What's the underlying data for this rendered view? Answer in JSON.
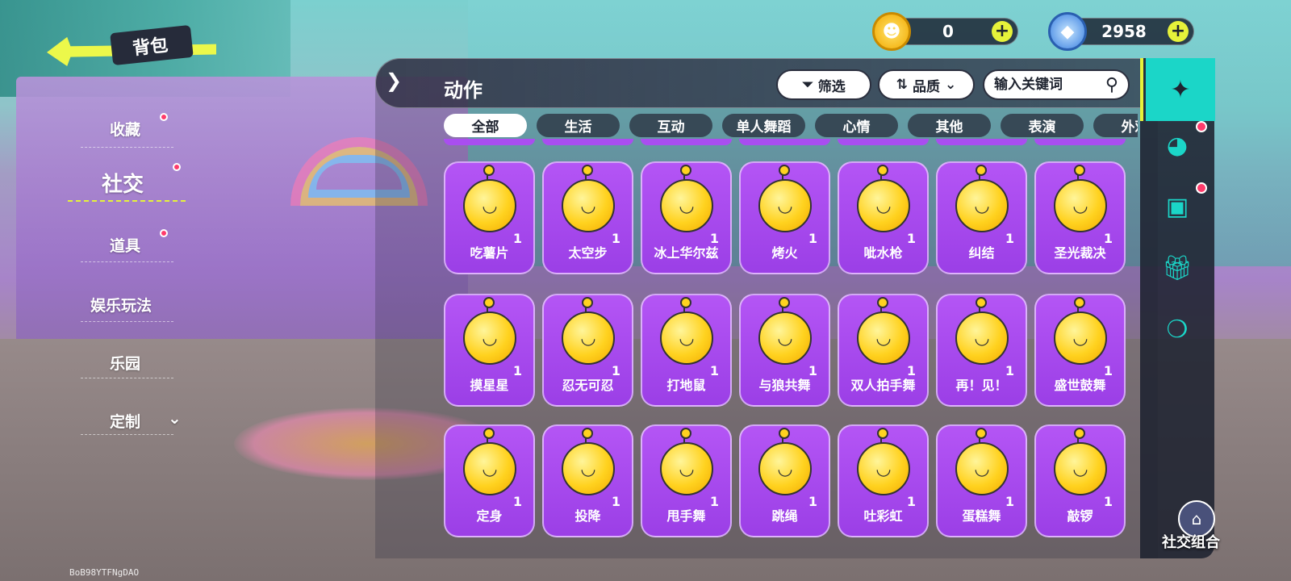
{
  "header": {
    "back_label": "背包"
  },
  "currencies": [
    {
      "name": "coin-currency",
      "amount": "0",
      "plus": "+"
    },
    {
      "name": "gem-currency",
      "amount": "2958",
      "plus": "+"
    }
  ],
  "left_nav": {
    "items": [
      {
        "label": "收藏",
        "has_dot": true
      },
      {
        "label": "社交",
        "has_dot": true,
        "active": true
      },
      {
        "label": "道具",
        "has_dot": true
      },
      {
        "label": "娱乐玩法",
        "has_dot": false
      },
      {
        "label": "乐园",
        "has_dot": false
      },
      {
        "label": "定制",
        "has_dot": false,
        "expand_icon": "chevron-down-icon"
      }
    ]
  },
  "panel": {
    "title": "动作",
    "filter_label": "筛选",
    "sort_label": "品质",
    "search_placeholder": "输入关键词"
  },
  "tabs": [
    "全部",
    "生活",
    "互动",
    "单人舞蹈",
    "心情",
    "其他",
    "表演",
    "外观"
  ],
  "items": [
    [
      {
        "name": "吃薯片",
        "count": "1"
      },
      {
        "name": "太空步",
        "count": "1"
      },
      {
        "name": "冰上华尔兹",
        "count": "1"
      },
      {
        "name": "烤火",
        "count": "1"
      },
      {
        "name": "呲水枪",
        "count": "1"
      },
      {
        "name": "纠结",
        "count": "1"
      },
      {
        "name": "圣光裁决",
        "count": "1"
      }
    ],
    [
      {
        "name": "摸星星",
        "count": "1"
      },
      {
        "name": "忍无可忍",
        "count": "1"
      },
      {
        "name": "打地鼠",
        "count": "1"
      },
      {
        "name": "与狼共舞",
        "count": "1"
      },
      {
        "name": "双人拍手舞",
        "count": "1"
      },
      {
        "name": "再！见！",
        "count": "1"
      },
      {
        "name": "盛世鼓舞",
        "count": "1"
      }
    ],
    [
      {
        "name": "定身",
        "count": "1"
      },
      {
        "name": "投降",
        "count": "1"
      },
      {
        "name": "甩手舞",
        "count": "1"
      },
      {
        "name": "跳绳",
        "count": "1"
      },
      {
        "name": "吐彩虹",
        "count": "1"
      },
      {
        "name": "蛋糕舞",
        "count": "1"
      },
      {
        "name": "敲锣",
        "count": "1"
      }
    ]
  ],
  "right_bar": {
    "icons": [
      "social-action-icon",
      "emote-icon",
      "photo-frame-icon",
      "gift-icon",
      "balloon-icon"
    ],
    "combo_label": "社交组合"
  },
  "version_text": "BoB98YTFNgDAO",
  "colors": {
    "accent_yellow": "#e6f23a",
    "card_purple": "#a94ef0",
    "teal": "#1bd6c8",
    "notify_red": "#ff3b6b"
  }
}
